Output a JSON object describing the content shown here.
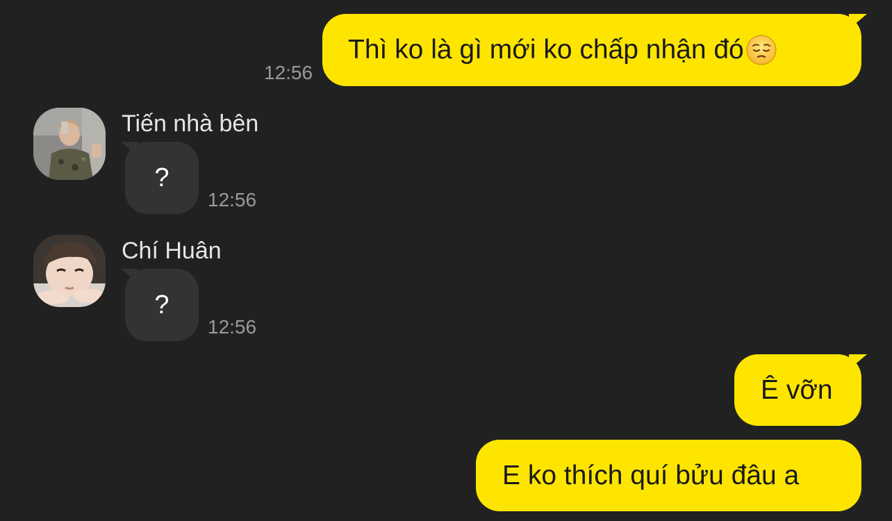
{
  "messages": {
    "m1": {
      "text": "Thì ko là gì mới ko chấp nhận đó",
      "emoji": "pensive-face",
      "time": "12:56"
    },
    "m2": {
      "sender": "Tiến nhà bên",
      "text": "?",
      "time": "12:56"
    },
    "m3": {
      "sender": "Chí Huân",
      "text": "?",
      "time": "12:56"
    },
    "m4": {
      "text": "Ê vỡn"
    },
    "m5": {
      "text": "E ko thích quí bửu đâu a"
    }
  },
  "colors": {
    "background": "#212121",
    "outgoing_bubble": "#FEE500",
    "incoming_bubble": "#333333",
    "timestamp": "#9a9a9a"
  }
}
